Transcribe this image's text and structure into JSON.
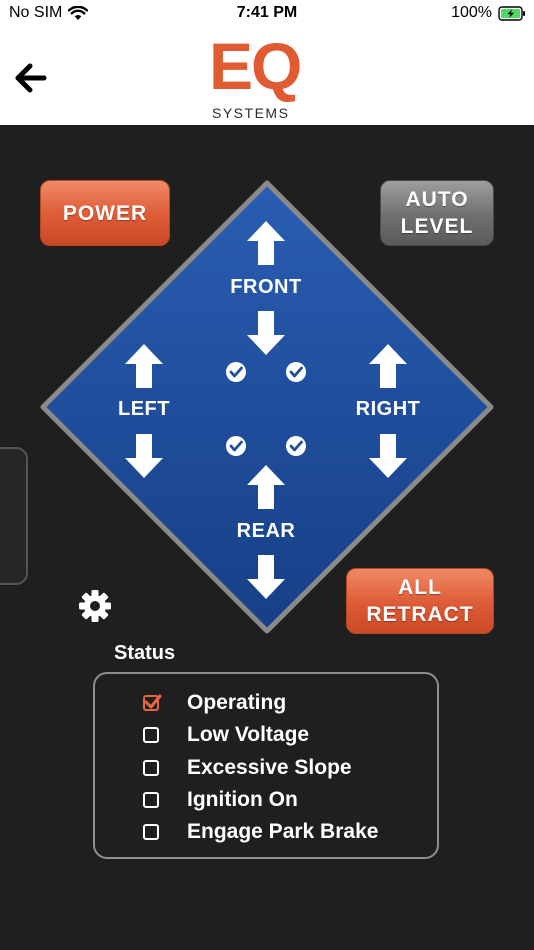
{
  "statusbar": {
    "carrier": "No SIM",
    "time": "7:41 PM",
    "battery": "100%"
  },
  "header": {
    "logo_main": "EQ",
    "logo_sub": "SYSTEMS"
  },
  "controls": {
    "power_label": "POWER",
    "auto_level_line1": "AUTO",
    "auto_level_line2": "LEVEL",
    "all_retract_line1": "ALL",
    "all_retract_line2": "RETRACT"
  },
  "diamond": {
    "front": "FRONT",
    "rear": "REAR",
    "left": "LEFT",
    "right": "RIGHT"
  },
  "status": {
    "title": "Status",
    "items": [
      {
        "label": "Operating",
        "checked": true
      },
      {
        "label": "Low Voltage",
        "checked": false
      },
      {
        "label": "Excessive Slope",
        "checked": false
      },
      {
        "label": "Ignition On",
        "checked": false
      },
      {
        "label": "Engage Park Brake",
        "checked": false
      }
    ]
  },
  "colors": {
    "accent": "#dd5a35",
    "diamond_blue": "#1e4f9c",
    "diamond_border": "#8a8a8a",
    "background": "#1f1f1f"
  }
}
